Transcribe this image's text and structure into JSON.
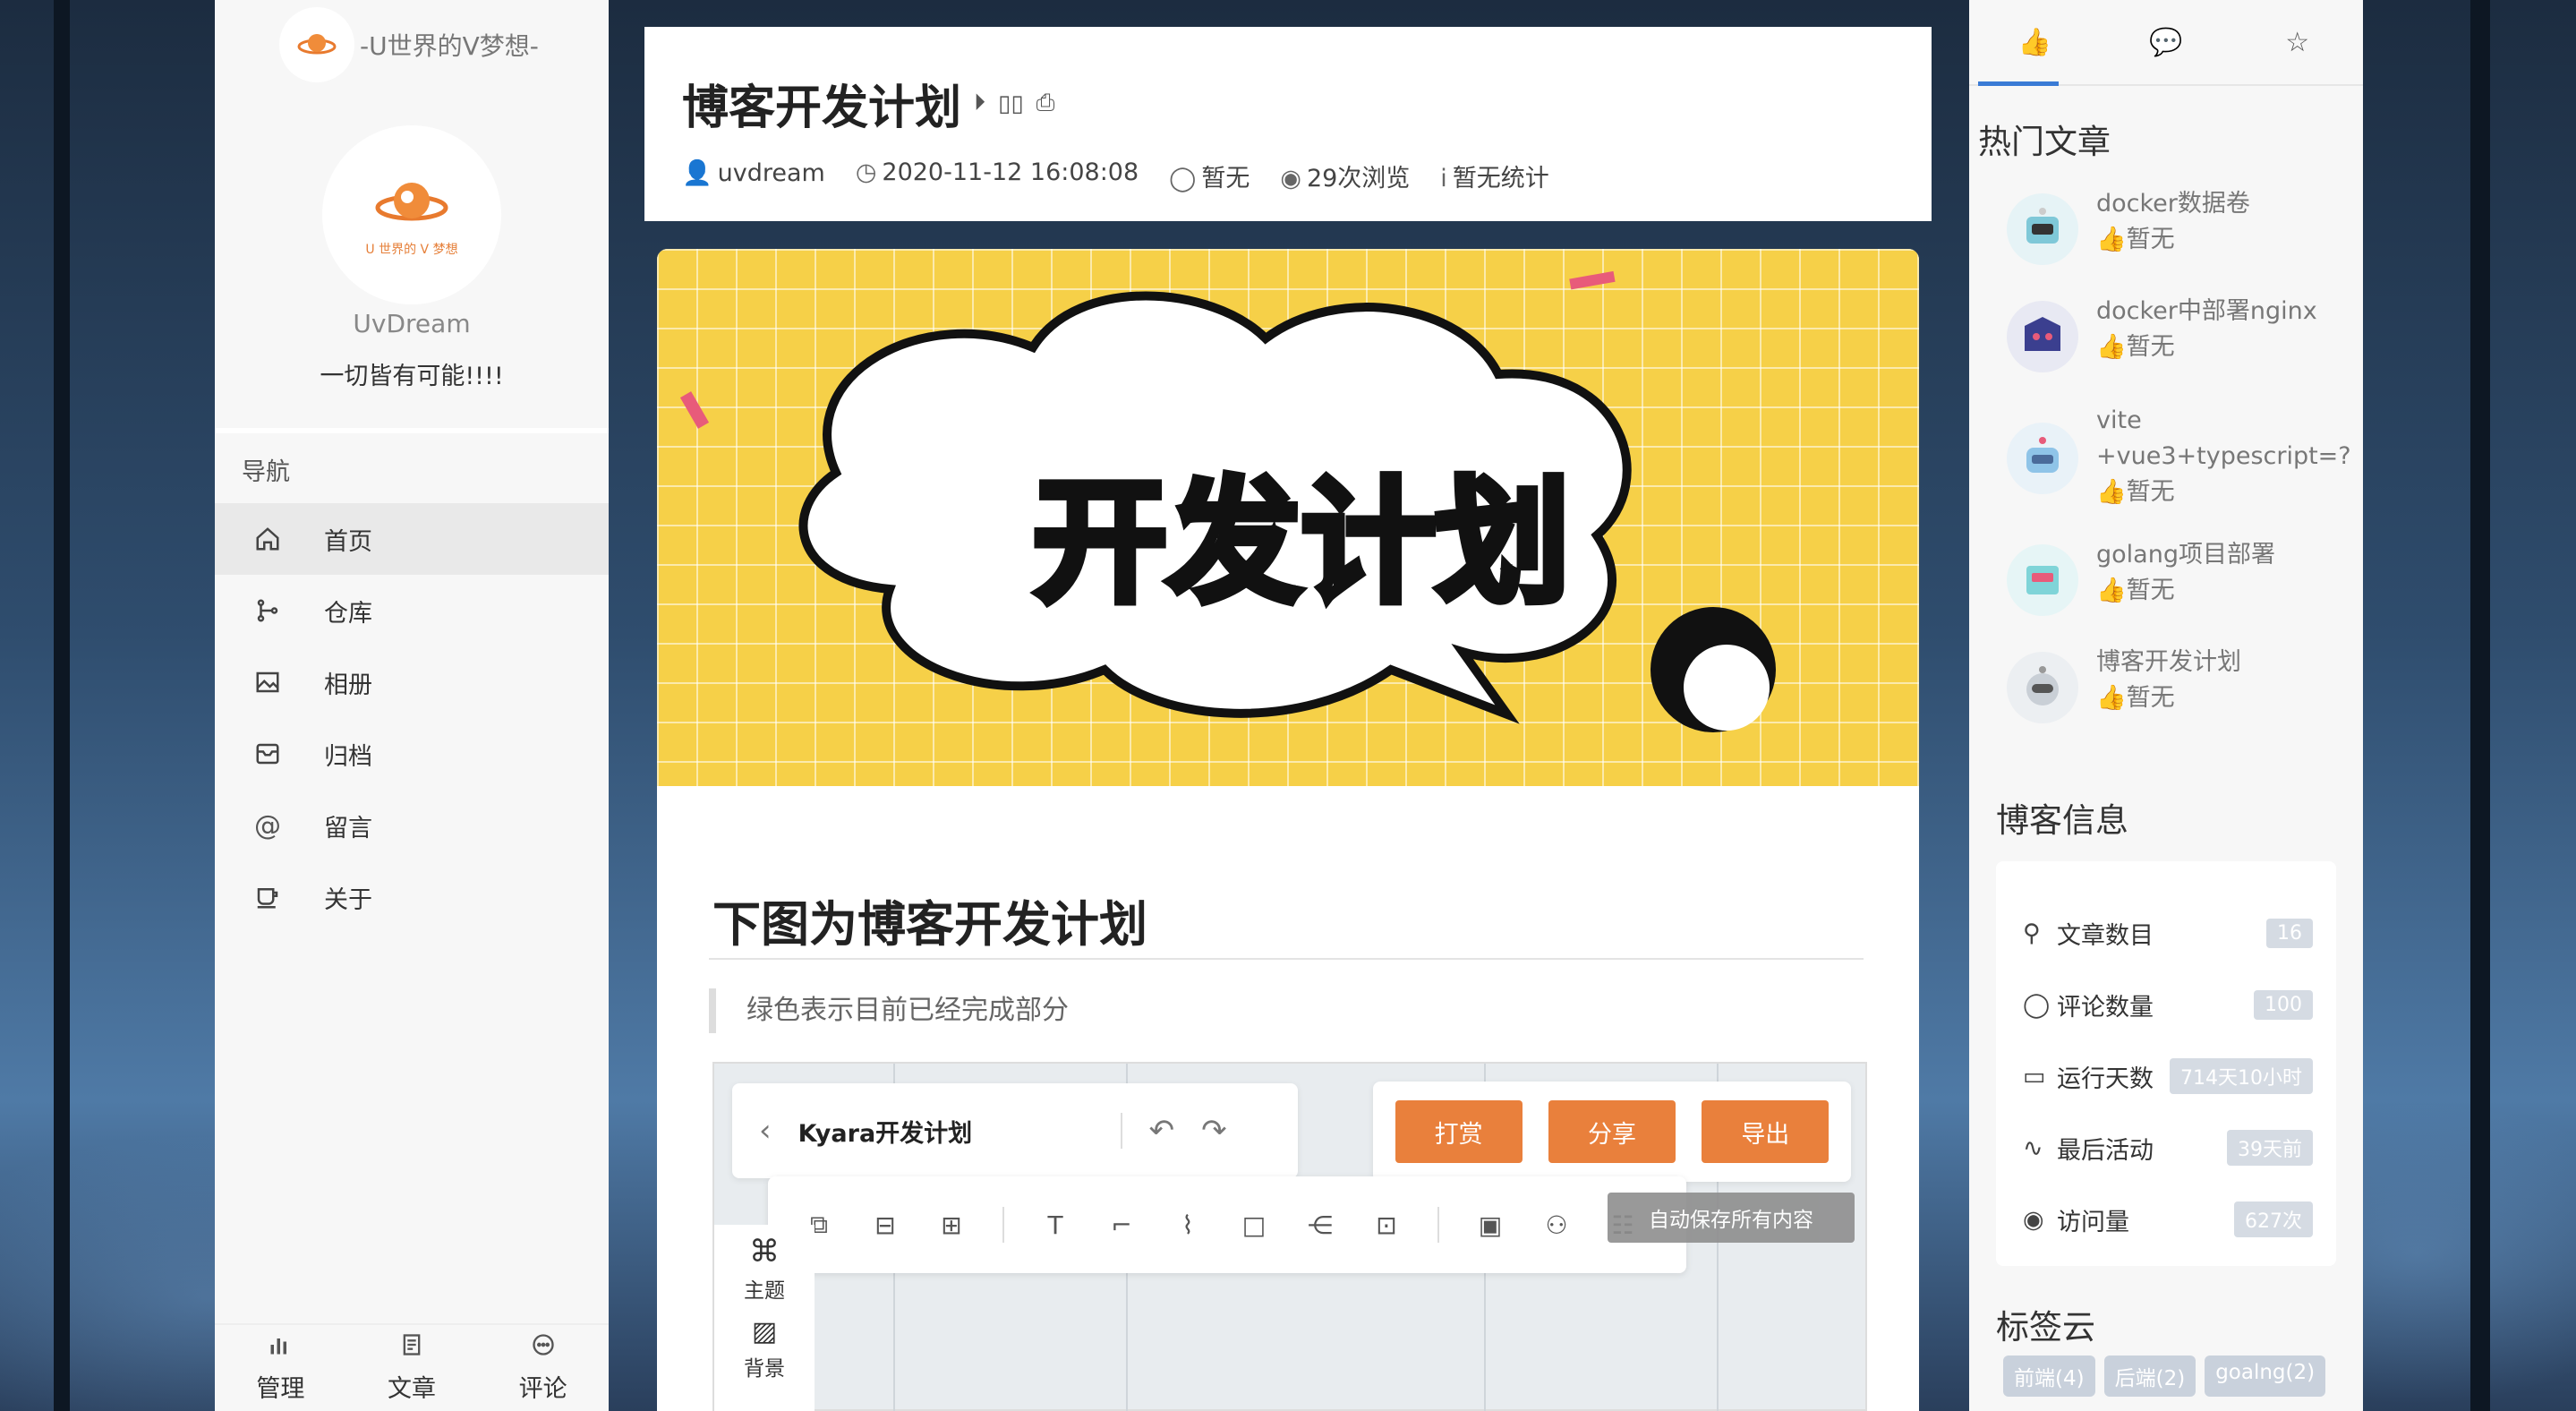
{
  "left_sidebar": {
    "brand": "-U世界的V梦想-",
    "logo_caption": "U 世界的 V 梦想",
    "username": "UvDream",
    "motto": "一切皆有可能!!!!",
    "nav_heading": "导航",
    "nav": [
      {
        "label": "首页",
        "icon": "home-icon",
        "active": true
      },
      {
        "label": "仓库",
        "icon": "git-branch-icon"
      },
      {
        "label": "相册",
        "icon": "image-icon"
      },
      {
        "label": "归档",
        "icon": "archive-icon"
      },
      {
        "label": "留言",
        "icon": "at-icon"
      },
      {
        "label": "关于",
        "icon": "cup-icon"
      }
    ],
    "bottom": [
      {
        "label": "管理",
        "icon": "bar-chart-icon"
      },
      {
        "label": "文章",
        "icon": "document-icon"
      },
      {
        "label": "评论",
        "icon": "comment-icon"
      }
    ]
  },
  "post": {
    "title": "博客开发计划",
    "author": "uvdream",
    "date": "2020-11-12 16:08:08",
    "comments": "暂无",
    "views": "29次浏览",
    "stats": "暂无统计",
    "banner_text": "开发计划",
    "heading": "下图为博客开发计划",
    "quote": "绿色表示目前已经完成部分"
  },
  "diagram": {
    "doc_title": "Kyara开发计划",
    "buttons": [
      "打赏",
      "分享",
      "导出"
    ],
    "autosave": "自动保存所有内容",
    "side_tools": [
      "主题",
      "背景"
    ]
  },
  "right_sidebar": {
    "hot_heading": "热门文章",
    "hot": [
      {
        "title": "docker数据卷",
        "likes": "暂无",
        "color": "#7fc8d8"
      },
      {
        "title": "docker中部署nginx",
        "likes": "暂无",
        "color": "#3b3f8f"
      },
      {
        "title": "vite +vue3+typescript=?",
        "likes": "暂无",
        "color": "#8fc4e8"
      },
      {
        "title": "golang项目部署",
        "likes": "暂无",
        "color": "#7fd4d8"
      },
      {
        "title": "博客开发计划",
        "likes": "暂无",
        "color": "#c9cfd6"
      }
    ],
    "info_heading": "博客信息",
    "info": [
      {
        "label": "文章数目",
        "value": "16",
        "icon": "rocket-icon"
      },
      {
        "label": "评论数量",
        "value": "100",
        "icon": "comment-icon"
      },
      {
        "label": "运行天数",
        "value": "714天10小时",
        "icon": "calendar-icon"
      },
      {
        "label": "最后活动",
        "value": "39天前",
        "icon": "pulse-icon"
      },
      {
        "label": "访问量",
        "value": "627次",
        "icon": "eye-icon"
      }
    ],
    "tags_heading": "标签云",
    "tags": [
      "前端(4)",
      "后端(2)",
      "goalng(2)"
    ]
  }
}
